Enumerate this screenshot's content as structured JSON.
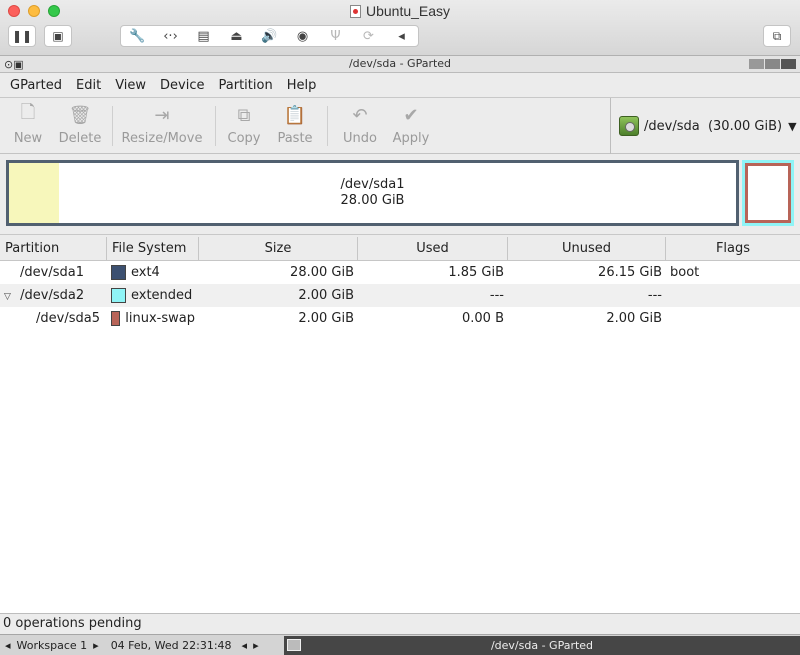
{
  "vm": {
    "title": "Ubuntu_Easy",
    "pause_icon": "pause-icon",
    "snapshot_icon": "snapshot-icon",
    "window_icon": "window-restore-icon"
  },
  "window": {
    "title": "/dev/sda - GParted"
  },
  "menu": {
    "gparted": "GParted",
    "edit": "Edit",
    "view": "View",
    "device": "Device",
    "partition": "Partition",
    "help": "Help"
  },
  "toolbar": {
    "new": "New",
    "delete": "Delete",
    "resize": "Resize/Move",
    "copy": "Copy",
    "paste": "Paste",
    "undo": "Undo",
    "apply": "Apply"
  },
  "device": {
    "name": "/dev/sda",
    "size": "(30.00 GiB)"
  },
  "diskmap": {
    "partition": "/dev/sda1",
    "size": "28.00 GiB"
  },
  "columns": {
    "partition": "Partition",
    "filesystem": "File System",
    "size": "Size",
    "used": "Used",
    "unused": "Unused",
    "flags": "Flags"
  },
  "rows": [
    {
      "partition": "/dev/sda1",
      "fs": "ext4",
      "fs_color": "#3c5070",
      "size": "28.00 GiB",
      "used": "1.85 GiB",
      "unused": "26.15 GiB",
      "flags": "boot"
    },
    {
      "partition": "/dev/sda2",
      "fs": "extended",
      "fs_color": "#8ff4f6",
      "size": "2.00 GiB",
      "used": "---",
      "unused": "---",
      "flags": ""
    },
    {
      "partition": "/dev/sda5",
      "fs": "linux-swap",
      "fs_color": "#b86458",
      "size": "2.00 GiB",
      "used": "0.00 B",
      "unused": "2.00 GiB",
      "flags": ""
    }
  ],
  "status": {
    "text": "0 operations pending"
  },
  "taskbar": {
    "workspace": "Workspace 1",
    "datetime": "04 Feb, Wed 22:31:48",
    "task": "/dev/sda - GParted"
  }
}
